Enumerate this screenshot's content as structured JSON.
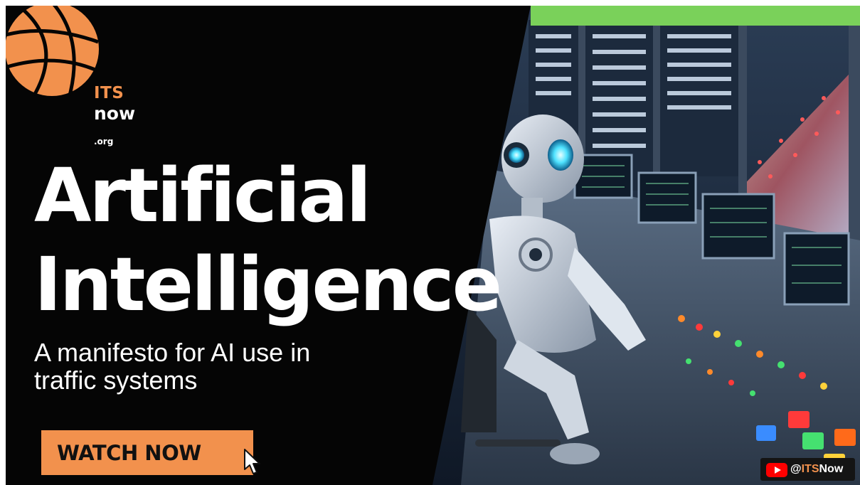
{
  "logo": {
    "icon": "globe-icon",
    "its": "ITS",
    "now": "now",
    "org": ".org",
    "color": "#f2914d"
  },
  "headline": {
    "line1": "Artificial",
    "line2": "Intelligence"
  },
  "subtitle": {
    "line1": "A manifesto for AI use in",
    "line2": "traffic systems"
  },
  "cta": {
    "label": "WATCH NOW",
    "color": "#f2914d"
  },
  "channel": {
    "icon": "youtube-icon",
    "at": "@",
    "highlight": "ITS",
    "rest": "Now"
  },
  "colors": {
    "accent_orange": "#f2914d",
    "accent_green": "#7ad15a",
    "background": "#050505"
  }
}
